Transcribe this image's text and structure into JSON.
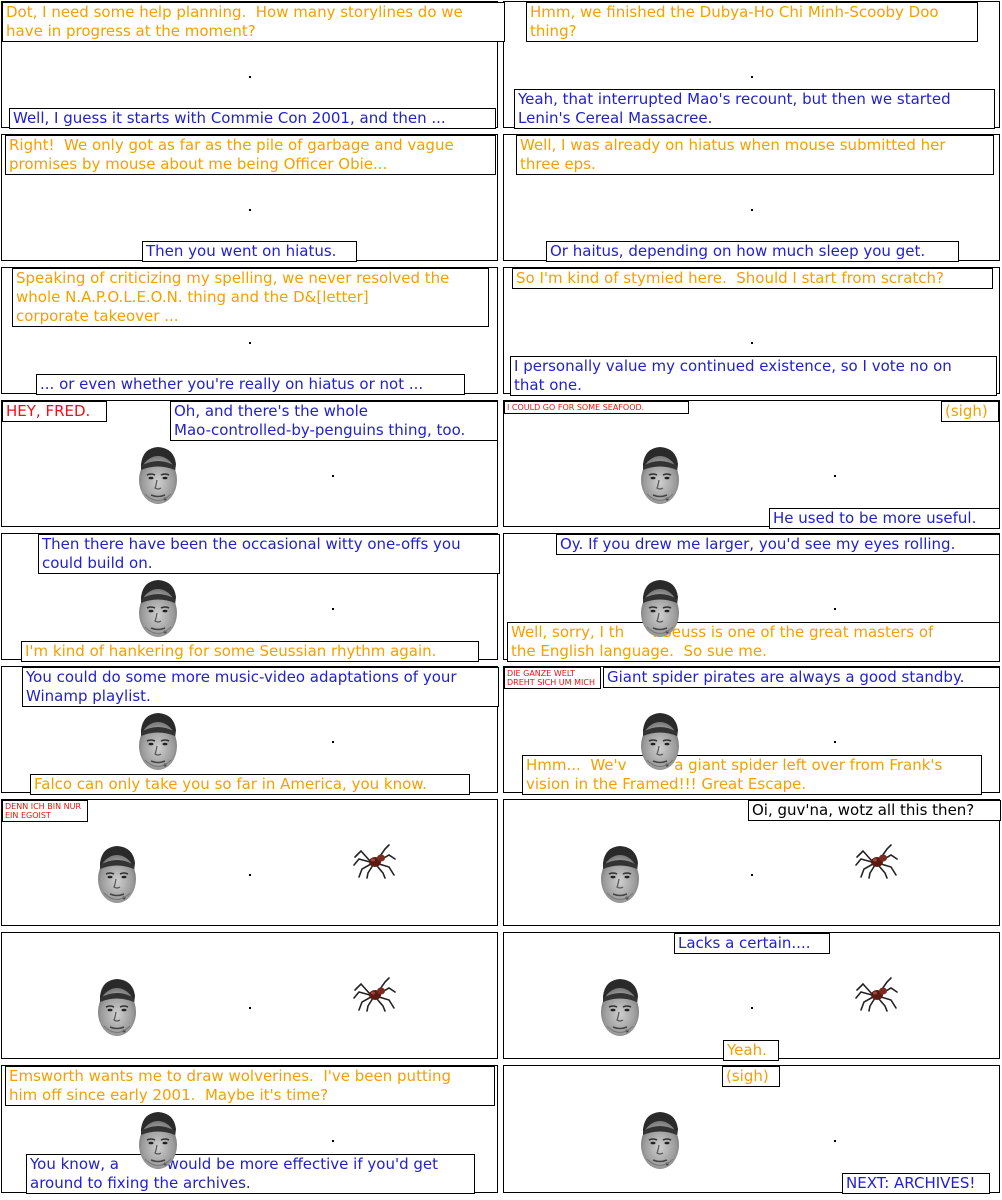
{
  "colors": {
    "dot": "#f5a000",
    "fred": "#2222cc",
    "shout": "#ee1111",
    "other": "#000000"
  },
  "panels": [
    {
      "bubbles": [
        {
          "speaker": "dot",
          "lines": [
            "Dot, I need some help planning.  How many storylines do we",
            "have in progress at the moment?"
          ]
        },
        {
          "speaker": "fred",
          "lines": [
            "Well, I guess it starts with Commie Con 2001, and then ..."
          ]
        }
      ]
    },
    {
      "bubbles": [
        {
          "speaker": "dot",
          "lines": [
            "Hmm, we finished the Dubya-Ho Chi Minh-Scooby Doo",
            "thing?"
          ]
        },
        {
          "speaker": "fred",
          "lines": [
            "Yeah, that interrupted Mao's recount, but then we started",
            "Lenin's Cereal Massacree."
          ]
        }
      ]
    },
    {
      "bubbles": [
        {
          "speaker": "dot",
          "lines": [
            "Right!  We only got as far as the pile of garbage and vague",
            "promises by mouse about me being Officer Obie..."
          ]
        },
        {
          "speaker": "fred",
          "lines": [
            "Then you went on hiatus."
          ]
        }
      ]
    },
    {
      "bubbles": [
        {
          "speaker": "dot",
          "lines": [
            "Well, I was already on hiatus when mouse submitted her",
            "three eps."
          ]
        },
        {
          "speaker": "fred",
          "lines": [
            "Or haitus, depending on how much sleep you get."
          ]
        }
      ]
    },
    {
      "bubbles": [
        {
          "speaker": "dot",
          "lines": [
            "Speaking of criticizing my spelling, we never resolved the",
            "whole N.A.P.O.L.E.O.N. thing and the D&[letter]",
            "corporate takeover ..."
          ]
        },
        {
          "speaker": "fred",
          "lines": [
            "... or even whether you're really on hiatus or not ..."
          ]
        }
      ]
    },
    {
      "bubbles": [
        {
          "speaker": "dot",
          "lines": [
            "So I'm kind of stymied here.  Should I start from scratch?"
          ]
        },
        {
          "speaker": "fred",
          "lines": [
            "I personally value my continued existence, so I vote no on",
            "that one."
          ]
        }
      ]
    },
    {
      "bubbles": [
        {
          "speaker": "shout",
          "lines": [
            "HEY, FRED."
          ]
        },
        {
          "speaker": "fred",
          "lines": [
            "Oh, and there's the whole",
            "Mao-controlled-by-penguins thing, too."
          ]
        }
      ]
    },
    {
      "bubbles": [
        {
          "speaker": "shout",
          "lines": [
            "I COULD GO FOR SOME SEAFOOD."
          ]
        },
        {
          "speaker": "dot",
          "lines": [
            "(sigh)"
          ]
        },
        {
          "speaker": "fred",
          "lines": [
            "He used to be more useful."
          ]
        }
      ]
    },
    {
      "bubbles": [
        {
          "speaker": "fred",
          "lines": [
            "Then there have been the occasional witty one-offs you",
            "could build on."
          ]
        },
        {
          "speaker": "dot",
          "lines": [
            "I'm kind of hankering for some Seussian rhythm again."
          ]
        }
      ]
    },
    {
      "bubbles": [
        {
          "speaker": "fred",
          "lines": [
            "Oy. If you drew me larger, you'd see my eyes rolling."
          ]
        },
        {
          "speaker": "dot",
          "lines": [
            "Well, sorry, I th      . Seuss is one of the great masters of",
            "the English language.  So sue me."
          ]
        }
      ]
    },
    {
      "bubbles": [
        {
          "speaker": "fred",
          "lines": [
            "You could do some more music-video adaptations of your",
            "Winamp playlist."
          ]
        },
        {
          "speaker": "dot",
          "lines": [
            "Falco can only take you so far in America, you know."
          ]
        }
      ]
    },
    {
      "bubbles": [
        {
          "speaker": "shout",
          "lines": [
            "DIE GANZE WELT",
            "DREHT SICH UM MICH"
          ]
        },
        {
          "speaker": "fred",
          "lines": [
            "Giant spider pirates are always a good standby."
          ]
        },
        {
          "speaker": "dot",
          "lines": [
            "Hmm...  We'v          a giant spider left over from Frank's",
            "vision in the Framed!!! Great Escape."
          ]
        }
      ]
    },
    {
      "bubbles": [
        {
          "speaker": "shout",
          "lines": [
            "DENN ICH BIN NUR",
            "EIN EGOIST"
          ]
        }
      ]
    },
    {
      "bubbles": [
        {
          "speaker": "other",
          "lines": [
            "Oi, guv'na, wotz all this then?"
          ]
        }
      ]
    },
    {
      "bubbles": []
    },
    {
      "bubbles": [
        {
          "speaker": "fred",
          "lines": [
            "Lacks a certain...."
          ]
        },
        {
          "speaker": "dot",
          "lines": [
            "Yeah."
          ]
        }
      ]
    },
    {
      "bubbles": [
        {
          "speaker": "dot",
          "lines": [
            "Emsworth wants me to draw wolverines.  I've been putting",
            "him off since early 2001.  Maybe it's time?"
          ]
        },
        {
          "speaker": "fred",
          "lines": [
            "You know, a          would be more effective if you'd get",
            "around to fixing the archives."
          ]
        }
      ]
    },
    {
      "bubbles": [
        {
          "speaker": "dot",
          "lines": [
            "(sigh)"
          ]
        },
        {
          "speaker": "fred",
          "lines": [
            "NEXT: ARCHIVES!"
          ]
        }
      ]
    }
  ]
}
